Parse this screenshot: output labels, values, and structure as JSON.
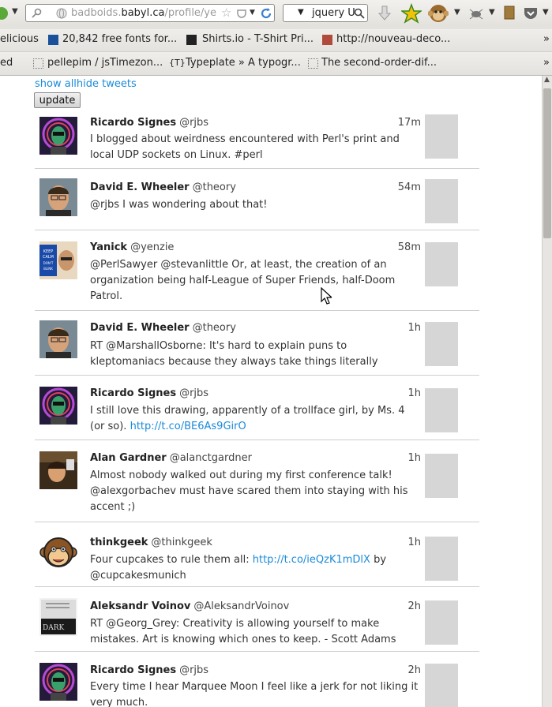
{
  "browser": {
    "url_gray": "badboids.",
    "url_dark": "babyl.ca",
    "url_rest": "/profile/ye",
    "search_text": "jquery U",
    "bookmarks_row1": [
      "elicious",
      "20,842 free fonts for...",
      "Shirts.io - T-Shirt Pri...",
      "http://nouveau-deco..."
    ],
    "bookmarks_row2": [
      "ed",
      "pellepim / jsTimezon...",
      "Typeplate » A typogr...",
      "The second-order-dif..."
    ],
    "overflow": "»"
  },
  "page": {
    "show_all": "show all",
    "hide_tweets": "hide tweets",
    "update_button": "update"
  },
  "tweets": [
    {
      "name": "Ricardo Signes",
      "handle": "@rjbs",
      "time": "17m",
      "text": "I blogged about weirdness encountered with Perl's print and local UDP sockets on Linux. #perl",
      "link": "",
      "after": "",
      "avatar": "rjbs"
    },
    {
      "name": "David E. Wheeler",
      "handle": "@theory",
      "time": "54m",
      "text": "@rjbs I was wondering about that!",
      "link": "",
      "after": "",
      "avatar": "theory"
    },
    {
      "name": "Yanick",
      "handle": "@yenzie",
      "time": "58m",
      "text": "@PerlSawyer @stevanlittle Or, at least, the creation of an organization being half-League of Super Friends, half-Doom Patrol.",
      "link": "",
      "after": "",
      "avatar": "yenzie"
    },
    {
      "name": "David E. Wheeler",
      "handle": "@theory",
      "time": "1h",
      "text": "RT @MarshallOsborne: It's hard to explain puns to kleptomaniacs because they always take things literally",
      "link": "",
      "after": "",
      "avatar": "theory"
    },
    {
      "name": "Ricardo Signes",
      "handle": "@rjbs",
      "time": "1h",
      "text": "I still love this drawing, apparently of a trollface girl, by Ms. 4 (or so). ",
      "link": "http://t.co/BE6As9GirO",
      "after": "",
      "avatar": "rjbs"
    },
    {
      "name": "Alan Gardner",
      "handle": "@alanctgardner",
      "time": "1h",
      "text": "Almost nobody walked out during my first conference talk! @alexgorbachev must have scared them into staying with his accent ;)",
      "link": "",
      "after": "",
      "avatar": "alan"
    },
    {
      "name": "thinkgeek",
      "handle": "@thinkgeek",
      "time": "1h",
      "text": "Four cupcakes to rule them all: ",
      "link": "http://t.co/ieQzK1mDlX",
      "after": " by @cupcakesmunich",
      "avatar": "thinkgeek"
    },
    {
      "name": "Aleksandr Voinov",
      "handle": "@AleksandrVoinov",
      "time": "2h",
      "text": "RT @Georg_Grey: Creativity is allowing yourself to make mistakes. Art is knowing which ones to keep. - Scott Adams",
      "link": "",
      "after": "",
      "avatar": "voinov"
    },
    {
      "name": "Ricardo Signes",
      "handle": "@rjbs",
      "time": "2h",
      "text": "Every time I hear Marquee Moon I feel like a jerk for not liking it very much.",
      "link": "",
      "after": "",
      "avatar": "rjbs"
    }
  ],
  "avatar_texts": {
    "yenzie_sign": "KEEP CALM AND DON'T BLINK",
    "voinov_cover": "DARK"
  },
  "colors": {
    "link": "#1a8bd8",
    "thumb": "#d6d6d6",
    "divider": "#cfcfcf"
  }
}
